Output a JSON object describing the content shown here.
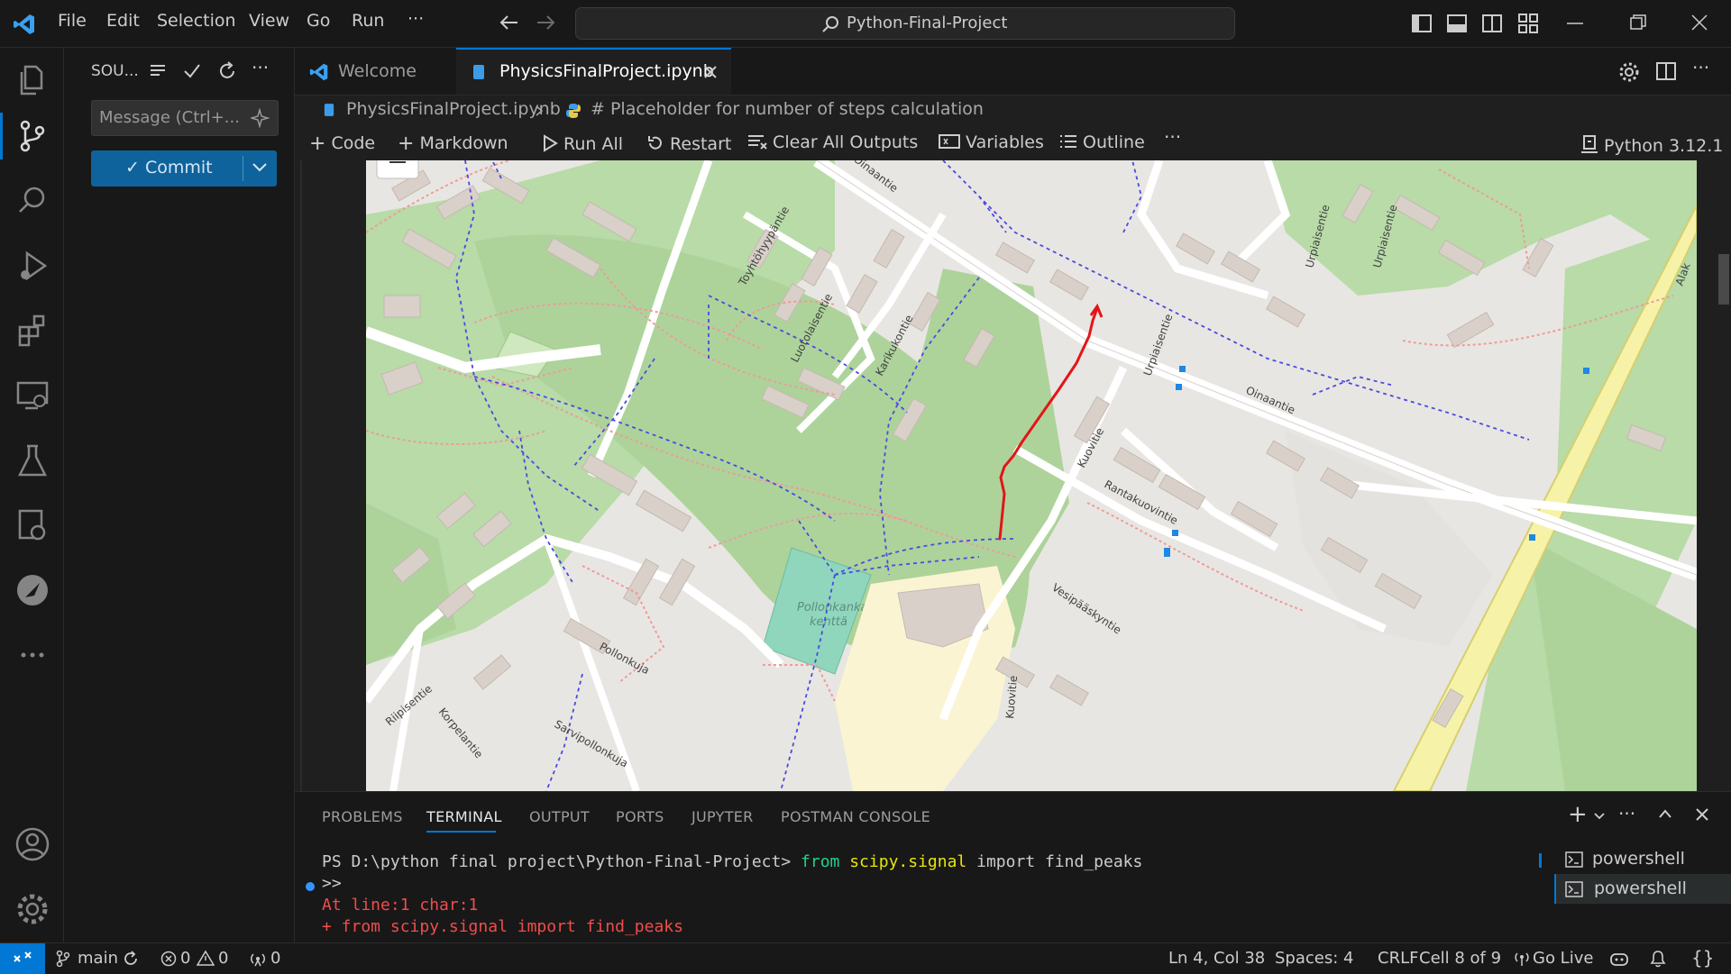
{
  "titlebar": {
    "menus": [
      "File",
      "Edit",
      "Selection",
      "View",
      "Go",
      "Run",
      "···"
    ],
    "search_text": "Python-Final-Project"
  },
  "sidebar": {
    "title": "SOU...",
    "message_placeholder": "Message (Ctrl+...",
    "commit_label": "✓ Commit"
  },
  "tabs": [
    {
      "label": "Welcome",
      "active": false
    },
    {
      "label": "PhysicsFinalProject.ipynb",
      "active": true
    }
  ],
  "breadcrumb": {
    "file": "PhysicsFinalProject.ipynb",
    "cell": "# Placeholder for number of steps calculation"
  },
  "toolbar": {
    "code": "Code",
    "markdown": "Markdown",
    "run_all": "Run All",
    "restart": "Restart",
    "clear_outputs": "Clear All Outputs",
    "variables": "Variables",
    "outline": "Outline",
    "kernel": "Python 3.12.1"
  },
  "map": {
    "street_labels": [
      "Oinaantie",
      "Oinaantie",
      "Urpiaisentie",
      "Urpiaisentie",
      "Urpiaisentie",
      "Alak",
      "Toyhtöhyypäntie",
      "Luotolaisentie",
      "Karikukontie",
      "Kuovitie",
      "Rantakuovintie",
      "Vesipääskyntie",
      "Kuovitie",
      "Pollonkuja",
      "Sarvipollonkuja",
      "Riipisentie",
      "Korpelantie",
      "Pollonkankaan",
      "kenttä"
    ],
    "route_color": "#e3151a"
  },
  "panel": {
    "tabs": [
      "PROBLEMS",
      "TERMINAL",
      "OUTPUT",
      "PORTS",
      "JUPYTER",
      "POSTMAN CONSOLE"
    ],
    "active_tab": "TERMINAL",
    "terminal": {
      "prompt": "PS D:\\python final project\\Python-Final-Project>",
      "cmd_from": "from",
      "cmd_module": "scipy.signal",
      "cmd_import": "import find_peaks",
      "continuation": ">>",
      "error_line1": "At line:1 char:1",
      "error_line2": "+ from scipy.signal import find_peaks"
    },
    "terminals": [
      "powershell",
      "powershell"
    ]
  },
  "statusbar": {
    "branch": "main",
    "errors": "0",
    "warnings": "0",
    "ports": "0",
    "position": "Ln 4, Col 38",
    "spaces": "Spaces: 4",
    "eol": "CRLF",
    "cell": "Cell 8 of 9",
    "golive": "Go Live"
  },
  "colors": {
    "accent": "#0078d4",
    "error": "#f14c4c",
    "terminal_yellow": "#e5e510",
    "terminal_green": "#23d18b"
  }
}
